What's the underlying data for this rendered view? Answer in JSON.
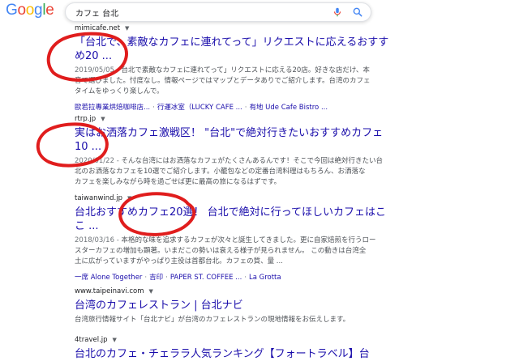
{
  "header": {
    "logo_letters": [
      {
        "ch": "G",
        "color": "#4285f4"
      },
      {
        "ch": "o",
        "color": "#ea4335"
      },
      {
        "ch": "o",
        "color": "#fbbc05"
      },
      {
        "ch": "g",
        "color": "#4285f4"
      },
      {
        "ch": "l",
        "color": "#34a853"
      },
      {
        "ch": "e",
        "color": "#ea4335"
      }
    ],
    "query": "カフェ 台北",
    "mic_icon": "microphone-icon",
    "search_icon": "magnifier-icon"
  },
  "results": [
    {
      "site": "mimicafe.net",
      "title_l1": "「台北で、素敵なカフェに連れてって」リクエストに応えるおすす",
      "title_l2": "め20 ...",
      "date": "2019/05/05 -",
      "snippet_l1": "台北で素敵なカフェに連れてって」リクエストに応える20店。好きな店だけ、本",
      "snippet_l2": "音で選びました。忖度なし。情報ページではマップとデータありでご紹介します。台湾のカフェ",
      "snippet_l3": "タイムをゆっくり楽しんで。",
      "sitelinks": [
        "歐若拉專業烘焙咖啡店...",
        "行運冰室（LUCKY CAFE ...",
        "有地 Ude Cafe Bistro ..."
      ]
    },
    {
      "site": "rtrp.jp",
      "title_l1": "実はお洒落カフェ激戦区！ \"台北\"で絶対行きたいおすすめカフェ",
      "title_l2": "10 ...",
      "date": "2020/01/22 -",
      "snippet_l1": "そんな台湾にはお洒落なカフェがたくさんあるんです！そこで今回は絶対行きたい台",
      "snippet_l2": "北のお洒落なカフェを10選でご紹介します。小籠包などの定番台湾料理はもちろん、お洒落な",
      "snippet_l3": "カフェを楽しみながら時を過ごせば更に最高の旅になるはずです。"
    },
    {
      "site": "taiwanwind.jp",
      "title_l1": "台北おすすめカフェ20選！ 台北で絶対に行ってほしいカフェはこ",
      "title_l2": "こ ...",
      "date": "2018/03/16 -",
      "snippet_l1": "本格的な味を追求するカフェが次々と誕生してきました。更に自家焙煎を行うロー",
      "snippet_l2": "スターカフェの増加も顕著。いまだこの勢いは衰える様子が見られません。 この動きは台湾全",
      "snippet_l3": "土に広がっていますがやっぱり主役は首都台北。カフェの質、量 ...",
      "sitelinks": [
        "一席 Alone Together",
        "吉印",
        "PAPER ST. COFFEE ...",
        "La Grotta"
      ]
    },
    {
      "site": "www.taipeinavi.com",
      "title_l1": "台湾のカフェレストラン | 台北ナビ",
      "snippet_l1": "台湾旅行情報サイト「台北ナビ」が台湾のカフェレストランの現地情報をお伝えします。"
    },
    {
      "site": "4travel.jp",
      "title_l1": "台北のカフェ・チェララ人気ランキング【フォートラベル】台"
    }
  ],
  "annotation_color": "#e01d1d"
}
